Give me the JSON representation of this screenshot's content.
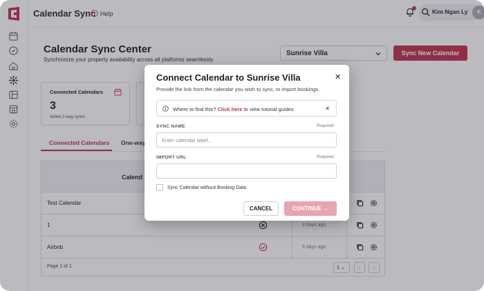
{
  "app": {
    "title": "Calendar Sync",
    "help_label": "Help"
  },
  "user": {
    "name": "Kim Ngan Ly",
    "avatar_initial": "K"
  },
  "sidebar": {
    "items": [
      {
        "icon": "calendar-icon"
      },
      {
        "icon": "tag-icon"
      },
      {
        "icon": "home-icon"
      },
      {
        "icon": "sync-icon"
      },
      {
        "icon": "layout-icon"
      },
      {
        "icon": "store-icon"
      },
      {
        "icon": "gear-icon"
      }
    ]
  },
  "page": {
    "title": "Calendar Sync Center",
    "subtitle": "Synchronize your property availability across all platforms seamlessly.",
    "property_selected": "Sunrise Villa",
    "sync_button": "Sync New Calendar"
  },
  "stats": {
    "connected": {
      "label": "Connected Calendars",
      "value": "3",
      "sub": "Active 2-way syncs"
    }
  },
  "tabs": [
    {
      "label": "Connected Calendars",
      "active": true
    },
    {
      "label": "One-way"
    }
  ],
  "table": {
    "header_calendar": "Calend",
    "rows": [
      {
        "name": "Test Calendar",
        "status": "",
        "time": ""
      },
      {
        "name": "1",
        "status": "error",
        "time": "9 days ago"
      },
      {
        "name": "Airbnb",
        "status": "ok",
        "time": "9 days ago"
      }
    ],
    "page_text": "Page 1 of 1",
    "page_size": "1"
  },
  "modal": {
    "title": "Connect Calendar to Sunrise Villa",
    "description": "Provide the link from the calendar you wish to sync, to import bookings.",
    "info_prefix": "Where to find this?",
    "info_link": "Click here",
    "info_suffix": "to view tutorial guides",
    "sync_name_label": "SYNC NAME",
    "sync_name_required": "Required",
    "sync_name_placeholder": "Enter calendar label...",
    "import_url_label": "IMPORT URL",
    "import_url_required": "Required",
    "import_url_placeholder": "",
    "checkbox_label": "Sync Calendar without Booking Data",
    "cancel_label": "CANCEL",
    "continue_label": "CONTINUE"
  },
  "colors": {
    "accent": "#c3314f",
    "accent_disabled": "#e8a4b2"
  }
}
